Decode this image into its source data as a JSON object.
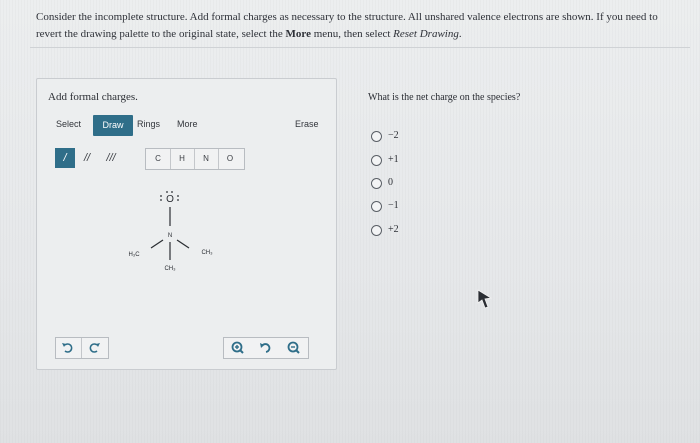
{
  "question": {
    "part1": "Consider the incomplete structure. Add formal charges as necessary to the structure. All unshared valence electrons are shown. If you need to revert the drawing palette to the original state, select the ",
    "more_word": "More",
    "part2": " menu, then select ",
    "reset_phrase": "Reset Drawing",
    "part3": "."
  },
  "panel": {
    "title": "Add formal charges.",
    "toolbar": {
      "select": "Select",
      "draw": "Draw",
      "rings": "Rings",
      "more": "More",
      "erase": "Erase"
    },
    "bonds": [
      "/",
      "//",
      "///"
    ],
    "atoms": [
      "C",
      "H",
      "N",
      "O"
    ],
    "structure": {
      "oxygen": "O",
      "nitrogen": "N",
      "left_methyl": "H₃C",
      "right_methyl": "CH₃",
      "bottom_methyl": "CH₃"
    },
    "bottom_icons": {
      "left": [
        "undo-icon",
        "redo-icon"
      ],
      "right": [
        "zoom-in-icon",
        "reset-zoom-icon",
        "zoom-out-icon"
      ]
    }
  },
  "mc": {
    "prompt": "What is the net charge on the species?",
    "options": [
      "−2",
      "+1",
      "0",
      "−1",
      "+2"
    ]
  },
  "colors": {
    "accent": "#2f6e89",
    "background": "#e9ebec"
  }
}
